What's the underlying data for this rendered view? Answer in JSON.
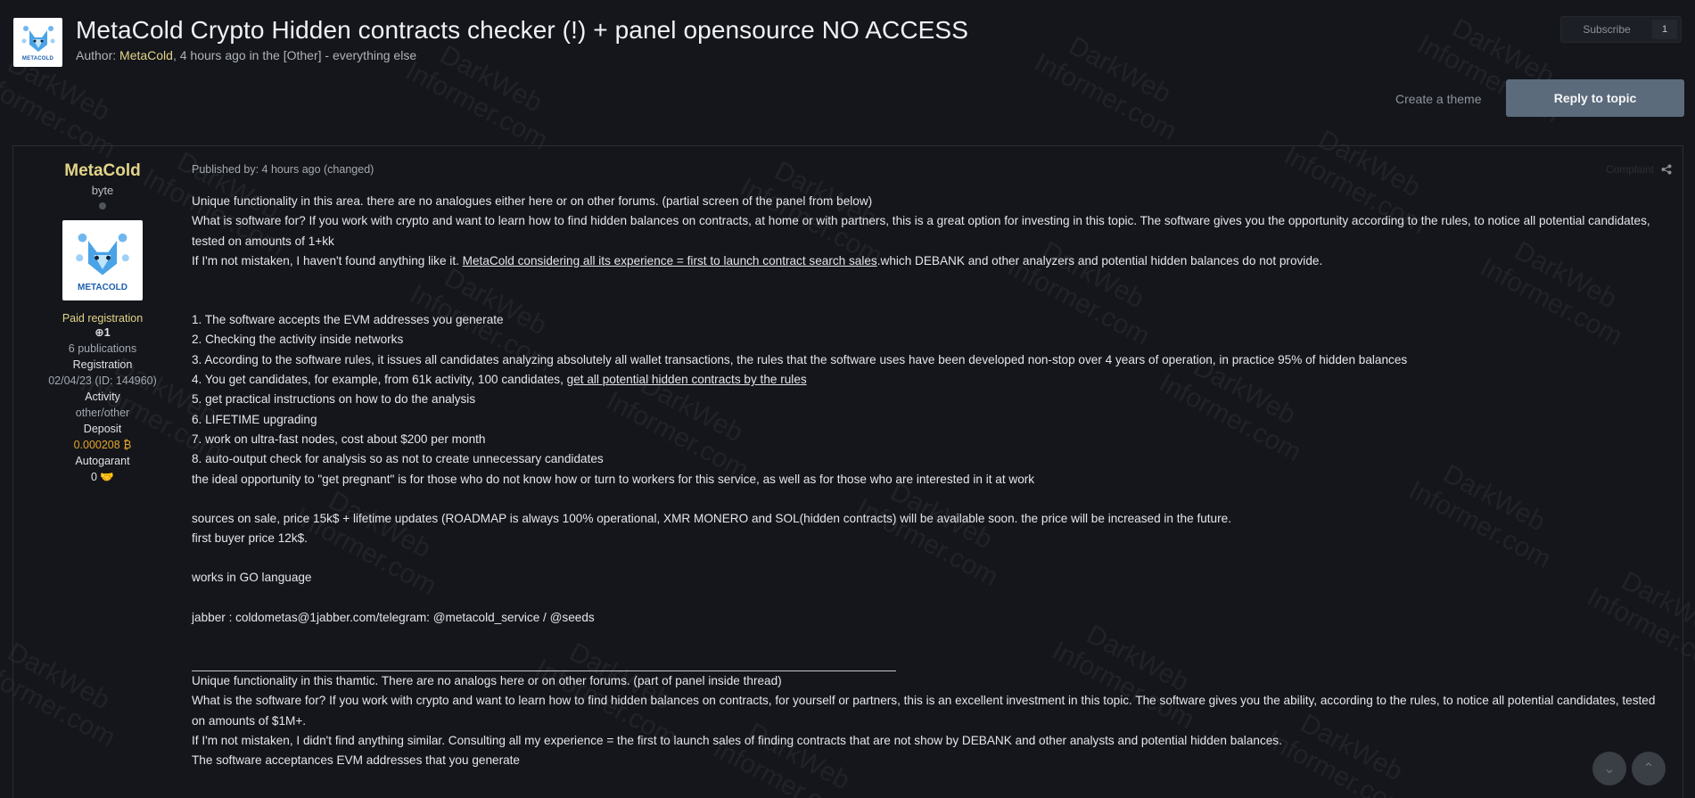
{
  "watermark": [
    "DarkWeb",
    "Informer.com"
  ],
  "topic": {
    "logo_text": "METACOLD",
    "title": "MetaCold Crypto Hidden contracts checker (!) + panel opensource NO ACCESS",
    "meta_prefix": "Author: ",
    "author": "MetaCold",
    "meta_suffix": ", 4 hours ago in the [Other] - everything else"
  },
  "subscribe": {
    "label": "Subscribe",
    "count": "1"
  },
  "actions": {
    "create_theme": "Create a theme",
    "reply": "Reply to topic"
  },
  "post": {
    "author": {
      "name": "MetaCold",
      "rank": "byte",
      "avatar_text": "METACOLD",
      "group": "Paid registration",
      "reputation": "⊕1",
      "publications": "6 publications",
      "registration_label": "Registration",
      "registration_value": "02/04/23 (ID: 144960)",
      "activity_label": "Activity",
      "activity_value": "other/other",
      "deposit_label": "Deposit",
      "deposit_value": "0.000208 ₿",
      "autogarant_label": "Autogarant",
      "autogarant_value": "0 🤝"
    },
    "published": "Published by: 4 hours ago (changed)",
    "complaint": "Complaint",
    "body": {
      "l1": "Unique functionality in this area. there are no analogues either here or on other forums. (partial screen of the panel from below)",
      "l2": "What is software for? If you work with crypto and want to learn how to find hidden balances on contracts, at home or with partners, this is a great option for investing in this topic. The software gives you the opportunity according to the rules, to notice all potential candidates, tested on amounts of 1+kk",
      "l3_pre": "If I'm not mistaken, I haven't found anything like it. ",
      "l3_link": "MetaCold considering all its experience = first to launch contract search sales",
      "l3_post": ".which DEBANK and other analyzers and potential hidden balances do not provide.",
      "i1": "1. The software accepts the EVM addresses you generate",
      "i2": "2. Checking the activity inside networks",
      "i3": "3. According to the software rules, it issues all candidates analyzing absolutely all wallet transactions, the rules that the software uses have been developed non-stop over 4 years of operation, in practice 95% of hidden balances",
      "i4_pre": "4. You get candidates, for example, from 61k activity, 100 candidates, ",
      "i4_link": "get all potential hidden contracts by the rules",
      "i5": "5. get practical instructions on how to do the analysis",
      "i6": "6. LIFETIME upgrading",
      "i7": "7. work on ultra-fast nodes, cost about $200 per month",
      "i8": "8. auto-output check for analysis so as not to create unnecessary candidates",
      "ideal": "the ideal opportunity to \"get pregnant\" is for those who do not know how or turn to workers for this service, as well as for those who are interested in it at work",
      "sale": "sources on sale, price 15k$ + lifetime updates (ROADMAP is always 100% operational, XMR MONERO and SOL(hidden contracts) will be available soon. the price will be increased in the future.",
      "first": "first buyer price 12k$.",
      "go": "works in GO language",
      "jabber": "jabber : coldometas@1jabber.com/telegram: @metacold_service / @seeds",
      "u1": "Unique functionality in this thamtic. There are no analogs here or on other forums. (part of panel inside thread)",
      "u2": "What is the software for? If you work with crypto and want to learn how to find hidden balances on contracts, for yourself or partners, this is an excellent investment in this topic. The software gives you the ability, according to the rules, to notice all potential candidates, tested on amounts of $1M+.",
      "u3": "If I'm not mistaken, I didn't find anything similar. Consulting all my experience = the first to launch sales of finding contracts that are not show by DEBANK and other analysts and potential hidden balances.",
      "u4": "The software acceptances EVM addresses that you generate"
    }
  },
  "colors": {
    "accent": "#e3d488",
    "reply_button": "#5c6b7b",
    "background": "#14161b"
  }
}
